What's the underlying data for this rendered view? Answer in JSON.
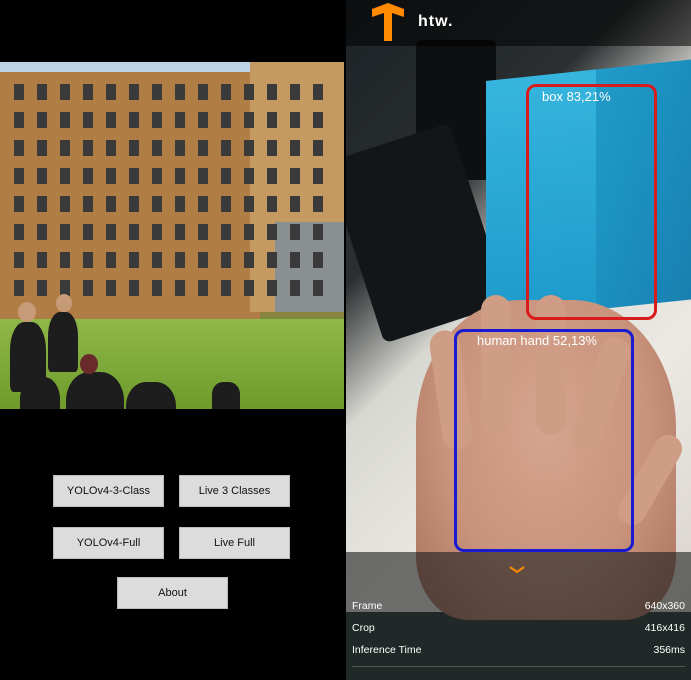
{
  "buttons": {
    "yolov4_3_class": "YOLOv4-3-Class",
    "live_3_classes": "Live 3 Classes",
    "yolov4_full": "YOLOv4-Full",
    "live_full": "Live Full",
    "about": "About"
  },
  "camera": {
    "brand_logo_text": "htw.",
    "detections": [
      {
        "label": "box 83,21%",
        "color": "#d81b1b"
      },
      {
        "label": "human hand 52,13%",
        "color": "#1a1ad0"
      }
    ]
  },
  "info_panel": {
    "rows": [
      {
        "label": "Frame",
        "value": "640x360"
      },
      {
        "label": "Crop",
        "value": "416x416"
      },
      {
        "label": "Inference Time",
        "value": "356ms"
      }
    ]
  },
  "colors": {
    "button_bg": "#dcdcdc",
    "tf_logo": "#ff8a00"
  }
}
